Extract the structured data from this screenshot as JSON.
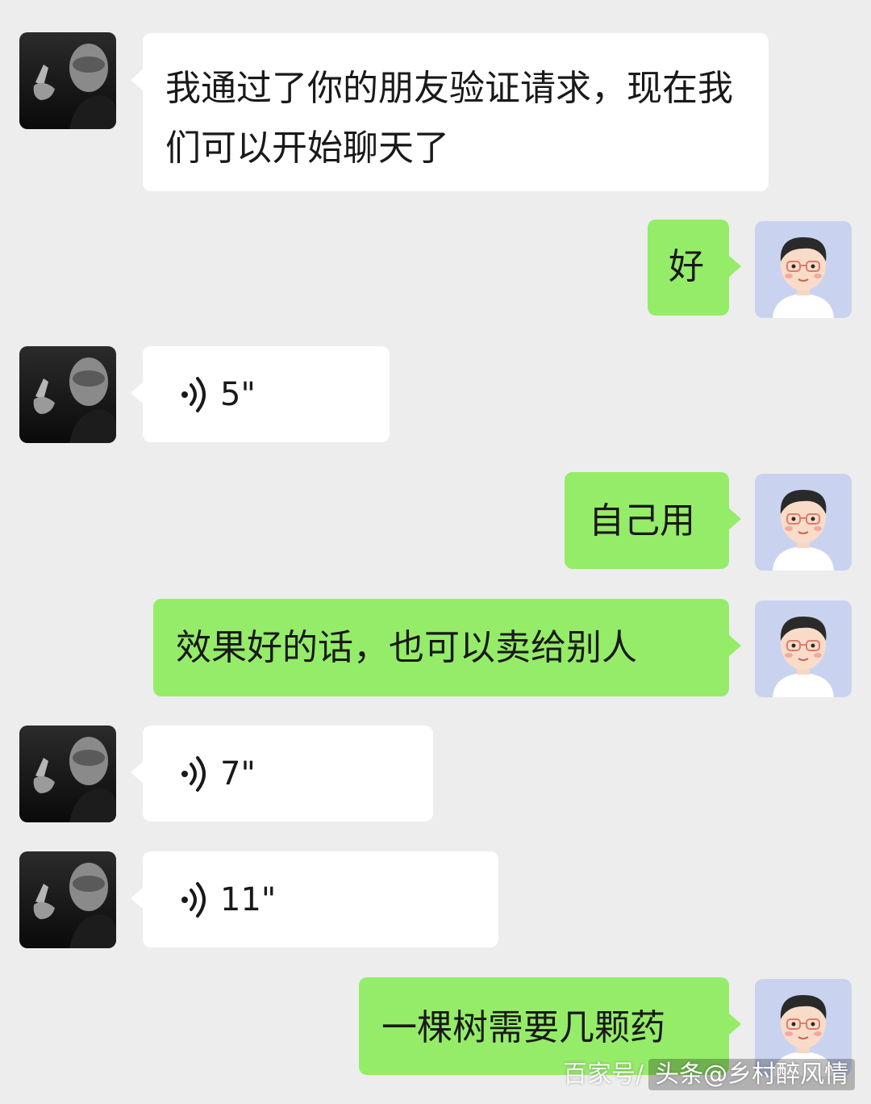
{
  "messages": [
    {
      "side": "left",
      "type": "text",
      "text": "我通过了你的朋友验证请求，现在我们可以开始聊天了"
    },
    {
      "side": "right",
      "type": "text",
      "text": "好"
    },
    {
      "side": "left",
      "type": "voice",
      "duration": "5\""
    },
    {
      "side": "right",
      "type": "text",
      "text": "自己用"
    },
    {
      "side": "right",
      "type": "text",
      "text": "效果好的话，也可以卖给别人"
    },
    {
      "side": "left",
      "type": "voice",
      "duration": "7\""
    },
    {
      "side": "left",
      "type": "voice",
      "duration": "11\""
    },
    {
      "side": "right",
      "type": "text",
      "text": "一棵树需要几颗药"
    }
  ],
  "watermark": {
    "left_text": "百家号/",
    "right_text": "头条@乡村醉风情"
  },
  "colors": {
    "background": "#ededed",
    "own_bubble": "#95ec69",
    "other_bubble": "#ffffff"
  },
  "icons": {
    "voice": "voice-wave-icon",
    "contact_avatar": "contact-avatar-photo",
    "own_avatar": "cartoon-boy-avatar"
  }
}
